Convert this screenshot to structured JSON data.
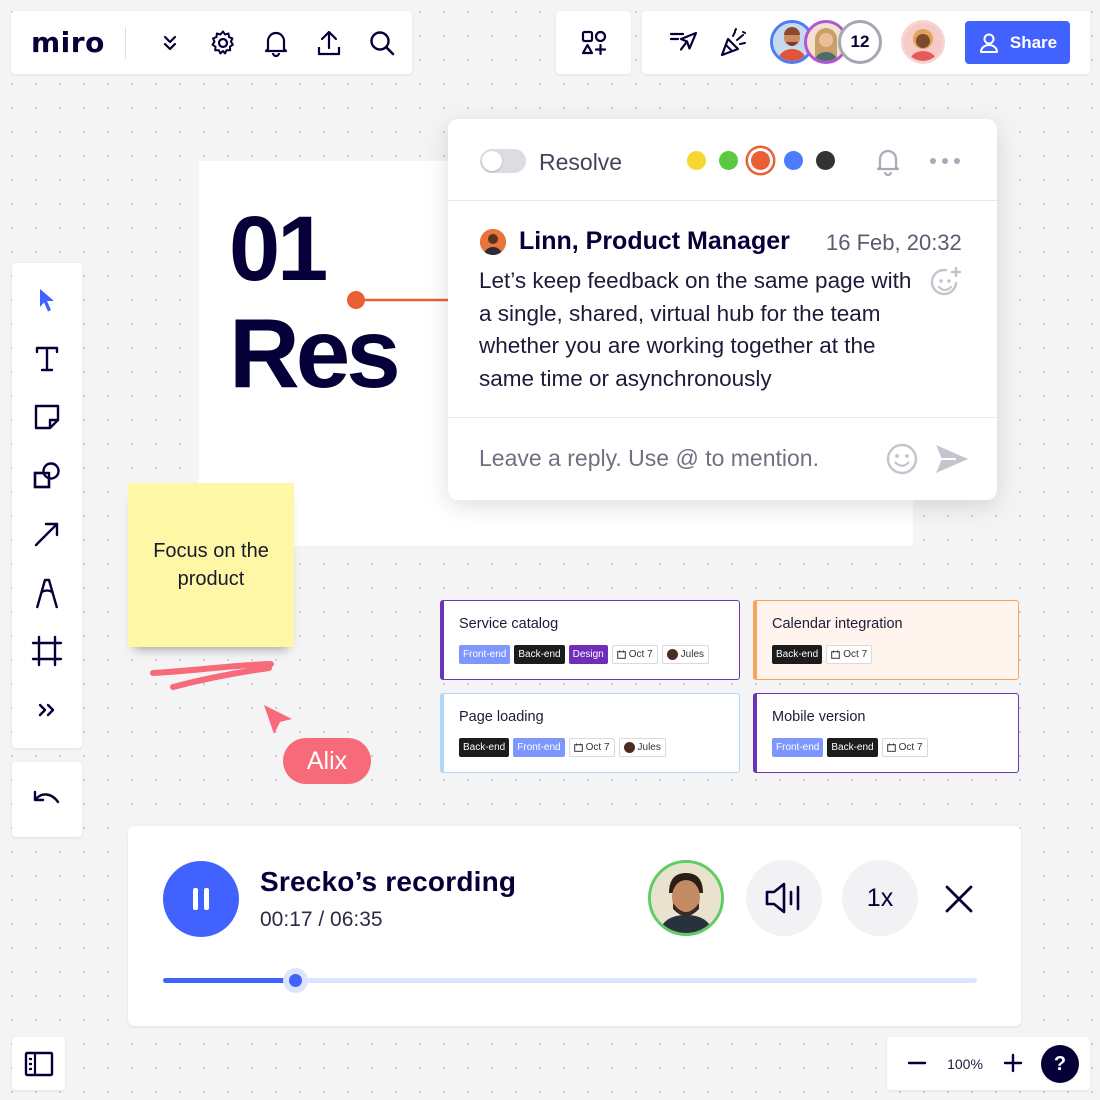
{
  "topbar": {
    "logo": "miro",
    "icons": [
      "chevron-double-down-icon",
      "gear-icon",
      "bell-icon",
      "upload-icon",
      "search-icon"
    ],
    "collaborators_overflow": "12",
    "share_label": "Share"
  },
  "toolbar": {
    "tools": [
      "select-icon",
      "text-icon",
      "sticky-note-icon",
      "shapes-icon",
      "arrow-icon",
      "pen-icon",
      "frame-icon",
      "more-tools-icon"
    ],
    "undo_icon": "undo-icon"
  },
  "frame": {
    "number": "01",
    "title": "Res"
  },
  "sticky": {
    "text": "Focus on the product",
    "color": "#fef7a5"
  },
  "cursor": {
    "name": "Alix",
    "color": "#f76a79"
  },
  "comment": {
    "resolve_label": "Resolve",
    "colors": [
      "#f5d632",
      "#5cc843",
      "#ea6035",
      "#4a7dfc",
      "#333333"
    ],
    "selected_color": "#ea6035",
    "author": "Linn, Product Manager",
    "date": "16 Feb, 20:32",
    "body": "Let’s keep feedback on the same page with a single, shared, virtual hub for the team whether you are working together at the same time or asynchronously",
    "reply_placeholder": "Leave a reply. Use @ to mention."
  },
  "cards": [
    {
      "title": "Service catalog",
      "border_color": "#6a35b8",
      "tags": [
        {
          "label": "Front-end",
          "kind": "frontend"
        },
        {
          "label": "Back-end",
          "kind": "backend"
        },
        {
          "label": "Design",
          "kind": "design"
        },
        {
          "label": "Oct 7",
          "kind": "date"
        },
        {
          "label": "Jules",
          "kind": "person"
        }
      ]
    },
    {
      "title": "Calendar integration",
      "border_color": "#f7a55c",
      "tags": [
        {
          "label": "Back-end",
          "kind": "backend"
        },
        {
          "label": "Oct 7",
          "kind": "date"
        }
      ]
    },
    {
      "title": "Page loading",
      "border_color": "#b3d6f7",
      "tags": [
        {
          "label": "Back-end",
          "kind": "backend"
        },
        {
          "label": "Front-end",
          "kind": "frontend"
        },
        {
          "label": "Oct 7",
          "kind": "date"
        },
        {
          "label": "Jules",
          "kind": "person"
        }
      ]
    },
    {
      "title": "Mobile version",
      "border_color": "#6a35b8",
      "tags": [
        {
          "label": "Front-end",
          "kind": "frontend"
        },
        {
          "label": "Back-end",
          "kind": "backend"
        },
        {
          "label": "Oct 7",
          "kind": "date"
        }
      ]
    }
  ],
  "recording": {
    "title": "Srecko’s recording",
    "time": "00:17 / 06:35",
    "progress": 0.163,
    "speed": "1x"
  },
  "zoom": {
    "level": "100%",
    "help": "?"
  }
}
